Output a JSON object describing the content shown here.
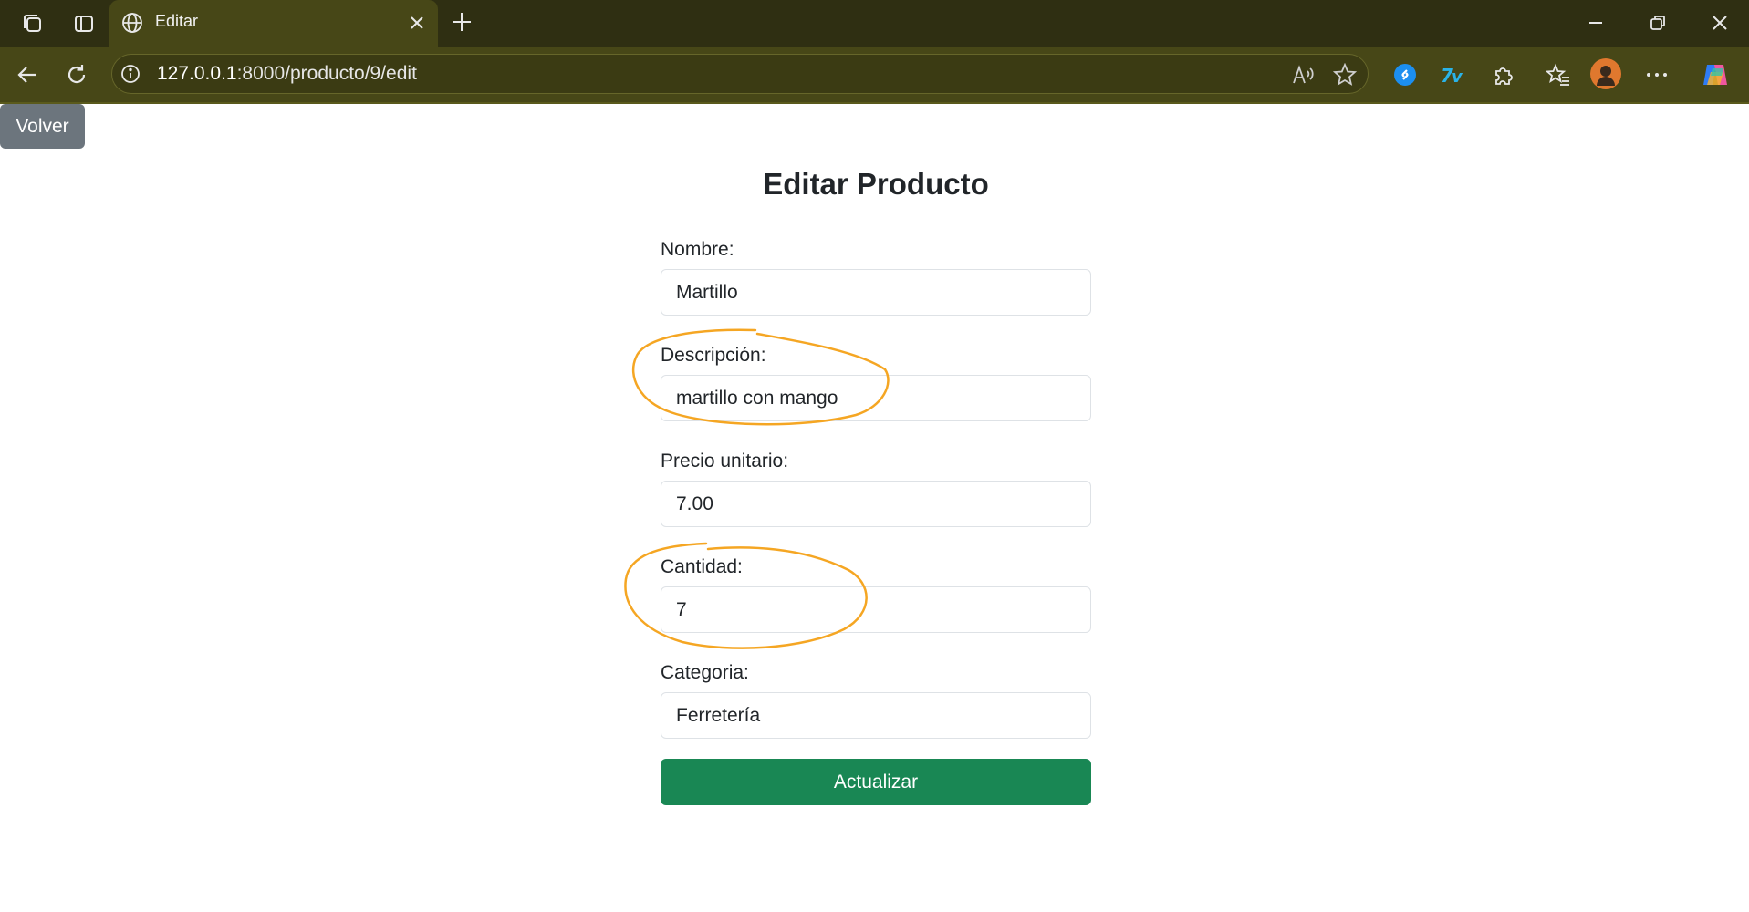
{
  "browser": {
    "tab_title": "Editar",
    "new_tab_symbol": "+",
    "url_host": "127.0.0.1",
    "url_rest": ":8000/producto/9/edit",
    "icons": [
      "workspaces-icon",
      "tab-actions-icon",
      "globe-icon",
      "close-tab-icon",
      "new-tab-icon",
      "minimize-icon",
      "restore-icon",
      "close-window-icon",
      "back-icon",
      "refresh-icon",
      "info-icon",
      "read-aloud-icon",
      "favorite-star-icon",
      "shazam-extension-icon",
      "translate-extension-icon",
      "extensions-icon",
      "favorites-icon",
      "profile-avatar",
      "more-icon",
      "copilot-icon"
    ]
  },
  "page": {
    "back_button": "Volver",
    "title": "Editar Producto",
    "fields": [
      {
        "label": "Nombre:",
        "value": "Martillo"
      },
      {
        "label": "Descripción:",
        "value": "martillo con mango"
      },
      {
        "label": "Precio unitario:",
        "value": "7.00"
      },
      {
        "label": "Cantidad:",
        "value": "7"
      },
      {
        "label": "Categoria:",
        "value": "Ferretería"
      }
    ],
    "submit_button": "Actualizar"
  },
  "colors": {
    "annotation": "#f5a623",
    "submit": "#198754",
    "back": "#6c757d",
    "chrome_dark": "#2f2f12",
    "chrome": "#474717"
  }
}
